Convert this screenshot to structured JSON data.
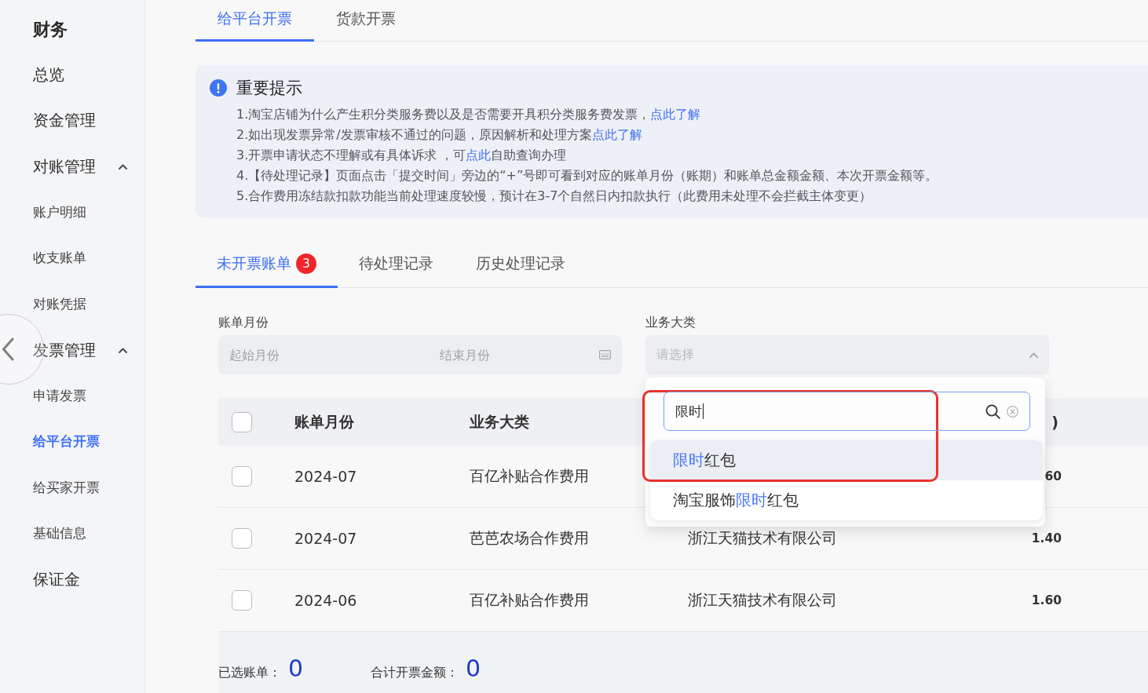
{
  "sidebar": {
    "title": "财务",
    "items": [
      {
        "label": "总览",
        "selected": false
      },
      {
        "label": "资金管理",
        "selected": false
      },
      {
        "label": "对账管理",
        "selected": false,
        "expanded": true,
        "children": [
          {
            "label": "账户明细",
            "selected": false
          },
          {
            "label": "收支账单",
            "selected": false
          },
          {
            "label": "对账凭据",
            "selected": false
          }
        ]
      },
      {
        "label": "发票管理",
        "selected": false,
        "expanded": true,
        "children": [
          {
            "label": "申请发票",
            "selected": false
          },
          {
            "label": "给平台开票",
            "selected": true
          },
          {
            "label": "给买家开票",
            "selected": false
          },
          {
            "label": "基础信息",
            "selected": false
          }
        ]
      },
      {
        "label": "保证金",
        "selected": false
      }
    ]
  },
  "tabs": [
    {
      "label": "给平台开票",
      "selected": true
    },
    {
      "label": "货款开票",
      "selected": false
    }
  ],
  "notice": {
    "title": "重要提示",
    "lines": [
      {
        "parts": [
          {
            "kind": "text",
            "text": "1.淘宝店铺为什么产生积分类服务费以及是否需要开具积分类服务费发票，"
          },
          {
            "kind": "link",
            "text": "点此了解"
          }
        ]
      },
      {
        "parts": [
          {
            "kind": "text",
            "text": "2.如出现发票异常/发票审核不通过的问题，原因解析和处理方案"
          },
          {
            "kind": "link",
            "text": "点此了解"
          }
        ]
      },
      {
        "parts": [
          {
            "kind": "text",
            "text": "3.开票申请状态不理解或有具体诉求 ，可"
          },
          {
            "kind": "link",
            "text": "点此"
          },
          {
            "kind": "text",
            "text": "自助查询办理"
          }
        ]
      },
      {
        "parts": [
          {
            "kind": "text",
            "text": "4.【待处理记录】页面点击「提交时间」旁边的“+”号即可看到对应的账单月份（账期）和账单总金额金额、本次开票金额等。"
          }
        ]
      },
      {
        "parts": [
          {
            "kind": "text",
            "text": "5.合作费用冻结款扣款功能当前处理速度较慢，预计在3-7个自然日内扣款执行（此费用未处理不会拦截主体变更）"
          }
        ]
      }
    ]
  },
  "record_tabs": [
    {
      "label": "未开票账单",
      "selected": true,
      "badge": "3"
    },
    {
      "label": "待处理记录",
      "selected": false
    },
    {
      "label": "历史处理记录",
      "selected": false
    }
  ],
  "filters": [
    {
      "kind": "month_range",
      "label": "账单月份",
      "start_placeholder": "起始月份",
      "end_placeholder": "结束月份"
    },
    {
      "kind": "select",
      "label": "业务大类",
      "placeholder": "请选择",
      "expanded": true,
      "dropdown": {
        "search_value": "限时",
        "options": [
          {
            "selected": true,
            "parts": [
              {
                "text": "限时",
                "match": true
              },
              {
                "text": "红包",
                "match": false
              }
            ]
          },
          {
            "selected": false,
            "parts": [
              {
                "text": "淘宝服饰",
                "match": false
              },
              {
                "text": "限时",
                "match": true
              },
              {
                "text": "红包",
                "match": false
              }
            ]
          }
        ]
      }
    }
  ],
  "table": {
    "header": {
      "checked": false,
      "bill_month": "账单月份",
      "business_category": "业务大类",
      "column_4": ")"
    },
    "rows": [
      {
        "checked": false,
        "bill_month": "2024-07",
        "business_category": "百亿补贴合作费用",
        "column_4": "60"
      },
      {
        "checked": false,
        "bill_month": "2024-07",
        "business_category": "芭芭农场合作费用",
        "column_3": "浙江天猫技术有限公司",
        "column_4": "1.40"
      },
      {
        "checked": false,
        "bill_month": "2024-06",
        "business_category": "百亿补贴合作费用",
        "column_3": "浙江天猫技术有限公司",
        "column_4": "1.60"
      }
    ]
  },
  "summary": [
    {
      "label": "已选账单：",
      "value": "0"
    },
    {
      "label": "合计开票金额：",
      "value": "0"
    }
  ]
}
